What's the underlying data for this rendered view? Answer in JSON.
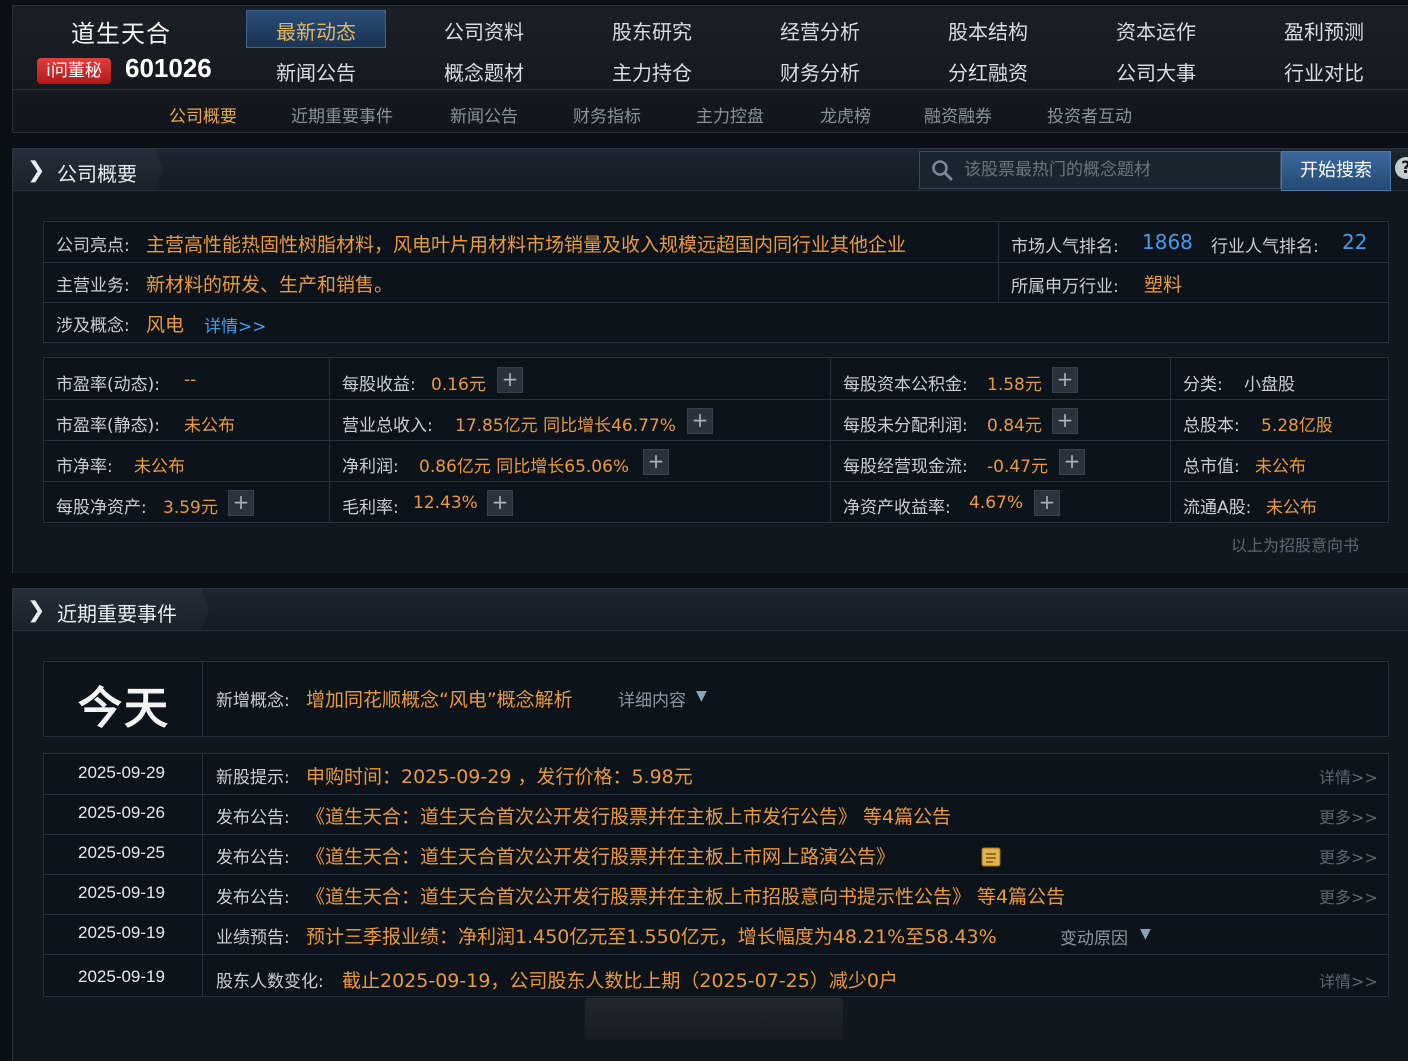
{
  "stock": {
    "name": "道生天合",
    "badge": "i问董秘",
    "code": "601026"
  },
  "nav": {
    "row1": [
      "最新动态",
      "公司资料",
      "股东研究",
      "经营分析",
      "股本结构",
      "资本运作",
      "盈利预测"
    ],
    "row2": [
      "新闻公告",
      "概念题材",
      "主力持仓",
      "财务分析",
      "分红融资",
      "公司大事",
      "行业对比"
    ],
    "active": "最新动态"
  },
  "subnav": [
    "公司概要",
    "近期重要事件",
    "新闻公告",
    "财务指标",
    "主力控盘",
    "龙虎榜",
    "融资融券",
    "投资者互动"
  ],
  "overview": {
    "title": "公司概要",
    "search": {
      "placeholder": "该股票最热门的概念题材",
      "button": "开始搜索",
      "help": "?"
    },
    "highlight_label": "公司亮点:",
    "highlight": "主营高性能热固性树脂材料，风电叶片用材料市场销量及收入规模远超国内同行业其他企业",
    "market_rank_label": "市场人气排名:",
    "market_rank": "1868",
    "industry_rank_label": "行业人气排名:",
    "industry_rank": "22",
    "business_label": "主营业务:",
    "business": "新材料的研发、生产和销售。",
    "sw_industry_label": "所属申万行业:",
    "sw_industry": "塑料",
    "concept_label": "涉及概念:",
    "concept": "风电",
    "concept_more": "详情>>",
    "metrics": {
      "pe_dyn_l": "市盈率(动态):",
      "pe_dyn_v": "--",
      "eps_l": "每股收益:",
      "eps_v": "0.16元",
      "capres_l": "每股资本公积金:",
      "capres_v": "1.58元",
      "class_l": "分类:",
      "class_v": "小盘股",
      "pe_static_l": "市盈率(静态):",
      "pe_static_v": "未公布",
      "rev_l": "营业总收入:",
      "rev_v": "17.85亿元 同比增长46.77%",
      "undist_l": "每股未分配利润:",
      "undist_v": "0.84元",
      "shares_l": "总股本:",
      "shares_v": "5.28亿股",
      "pb_l": "市净率:",
      "pb_v": "未公布",
      "np_l": "净利润:",
      "np_v": "0.86亿元 同比增长65.06%",
      "cf_l": "每股经营现金流:",
      "cf_v": "-0.47元",
      "mcap_l": "总市值:",
      "mcap_v": "未公布",
      "bvps_l": "每股净资产:",
      "bvps_v": "3.59元",
      "gm_l": "毛利率:",
      "gm_v": "12.43%",
      "roe_l": "净资产收益率:",
      "roe_v": "4.67%",
      "float_l": "流通A股:",
      "float_v": "未公布"
    },
    "footnote": "以上为招股意向书"
  },
  "events": {
    "title": "近期重要事件",
    "today": "今天",
    "today_label": "新增概念:",
    "today_text": "增加同花顺概念“风电”概念解析",
    "today_more": "详细内容",
    "rows": [
      {
        "date": "2025-09-29",
        "label": "新股提示:",
        "text": "申购时间：2025-09-29 ，发行价格：5.98元",
        "more": "详情>>"
      },
      {
        "date": "2025-09-26",
        "label": "发布公告:",
        "text": "《道生天合：道生天合首次公开发行股票并在主板上市发行公告》 等4篇公告",
        "more": "更多>>"
      },
      {
        "date": "2025-09-25",
        "label": "发布公告:",
        "text": "《道生天合：道生天合首次公开发行股票并在主板上市网上路演公告》",
        "more": "更多>>"
      },
      {
        "date": "2025-09-19",
        "label": "发布公告:",
        "text": "《道生天合：道生天合首次公开发行股票并在主板上市招股意向书提示性公告》 等4篇公告",
        "more": "更多>>"
      },
      {
        "date": "2025-09-19",
        "label": "业绩预告:",
        "text": "预计三季报业绩：净利润1.450亿元至1.550亿元，增长幅度为48.21%至58.43%",
        "more": "变动原因"
      },
      {
        "date": "2025-09-19",
        "label": "股东人数变化:",
        "text": "截止2025-09-19，公司股东人数比上期（2025-07-25）减少0户",
        "more": "详情>>"
      }
    ]
  }
}
